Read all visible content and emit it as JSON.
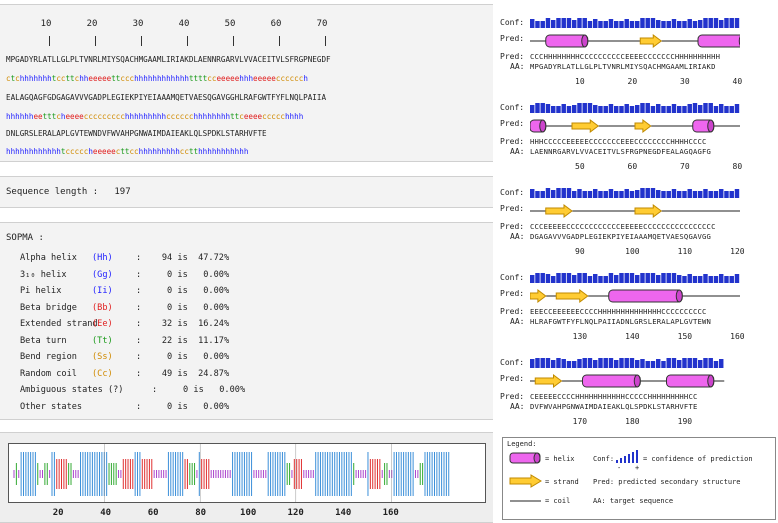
{
  "sequence_panel": {
    "ruler_labels": [
      "10",
      "20",
      "30",
      "40",
      "50",
      "60",
      "70"
    ],
    "lines": [
      {
        "aa": "MPGADYRLATLLGLPLTVNRLMIYSQACHMGAAMLIRIAKDLAENNRGARVLVVACEITVLSFRGPNEGDF",
        "ss": "ctchhhhhhhtccttchheeeeettccchhhhhhhhhhhhttttcceeeeehhheeeeecccccch"
      },
      {
        "aa": "EALAGQAGFGDGAGAVVVGADPLEGIEKPIYEIAAAMQETVAESQGAVGGHLRAFGWTFYFLNQLPAIIA",
        "ss": "hhhhhheetttcheeeeccccccccchhhhhhhhhcccccchhhhhhhhttceeeeccccchhhh"
      },
      {
        "aa": "DNLGRSLERALAPLGVTEWNDVFWVAHPGNWAIMDAIEAKLQLSPDKLSTARHVFTE",
        "ss": "hhhhhhhhhhhhtcccccheeeeecttcchhhhhhhhhcctthhhhhhhhhhh"
      }
    ]
  },
  "length_row": {
    "label": "Sequence length :",
    "value": "197"
  },
  "sopma": {
    "title": "SOPMA :",
    "rows": [
      {
        "name": "Alpha helix",
        "code": "(Hh)",
        "color": "#2222ff",
        "rest": ":    94 is  47.72%"
      },
      {
        "name": "3₁₀ helix",
        "code": "(Gg)",
        "color": "#2222ff",
        "rest": ":     0 is   0.00%"
      },
      {
        "name": "Pi helix",
        "code": "(Ii)",
        "color": "#2222ff",
        "rest": ":     0 is   0.00%"
      },
      {
        "name": "Beta bridge",
        "code": "(Bb)",
        "color": "#e02020",
        "rest": ":     0 is   0.00%"
      },
      {
        "name": "Extended strand",
        "code": "(Ee)",
        "color": "#e02020",
        "rest": ":    32 is  16.24%"
      },
      {
        "name": "Beta turn",
        "code": "(Tt)",
        "color": "#1a9a1a",
        "rest": ":    22 is  11.17%"
      },
      {
        "name": "Bend region",
        "code": "(Ss)",
        "color": "#d08a00",
        "rest": ":     0 is   0.00%"
      },
      {
        "name": "Random coil",
        "code": "(Cc)",
        "color": "#d08a00",
        "rest": ":    49 is  24.87%"
      },
      {
        "name": "Ambiguous states (?)",
        "code": "",
        "color": "#222222",
        "rest": ":     0 is   0.00%"
      },
      {
        "name": "Other states",
        "code": "",
        "color": "#222222",
        "rest": ":     0 is   0.00%"
      }
    ]
  },
  "track_labels": [
    "20",
    "40",
    "60",
    "80",
    "100",
    "120",
    "140",
    "160"
  ],
  "psipred_blocks": [
    {
      "conf_label": "Conf:",
      "pred_label": "Pred:",
      "aa_label": "AA:",
      "pred": "CCCHHHHHHHHCCCCCCCCCCEEEECCCCCCCHHHHHHHHHH",
      "aa": "MPGADYRLATLLGLPLTVNRLMIYSQACHMGAAMLIRIAKD",
      "positions": [
        "10",
        "20",
        "30",
        "40"
      ]
    },
    {
      "conf_label": "Conf:",
      "pred_label": "Pred:",
      "aa_label": "AA:",
      "pred": "HHHCCCCCEEEEECCCCCCCEEECCCCCCCCHHHHCCCC",
      "aa": "LAENNRGARVLVVACEITVLSFRGPNEGDFEALAGQAGFG",
      "positions": [
        "50",
        "60",
        "70",
        "80"
      ]
    },
    {
      "conf_label": "Conf:",
      "pred_label": "Pred:",
      "aa_label": "AA:",
      "pred": "CCCEEEEECCCCCCCCCCCCEEEEECCCCCCCCCCCCCCCC",
      "aa": "DGAGAVVVGADPLEGIEKPIYEIAAAMQETVAESQGAVGG",
      "positions": [
        "90",
        "100",
        "110",
        "120"
      ]
    },
    {
      "conf_label": "Conf:",
      "pred_label": "Pred:",
      "aa_label": "AA:",
      "pred": "EEECCEEEEEECCCCHHHHHHHHHHHHHHCCCCCCCCCC",
      "aa": "HLRAFGWTFYFLNQLPAIIADNLGRSLERALAPLGVTEWN",
      "positions": [
        "130",
        "140",
        "150",
        "160"
      ]
    },
    {
      "conf_label": "Conf:",
      "pred_label": "Pred:",
      "aa_label": "AA:",
      "pred": "CEEEEECCCCHHHHHHHHHHHCCCCCHHHHHHHHHCC",
      "aa": "DVFWVAHPGNWAIMDAIEAKLQLSPDKLSTARHVFTE",
      "positions": [
        "170",
        "180",
        "190"
      ]
    }
  ],
  "legend": {
    "title": "Legend:",
    "helix": "= helix",
    "conf": "Conf:",
    "conf_desc": "= confidence of prediction",
    "minus": "-",
    "plus": "+",
    "strand": "= strand",
    "pred": "Pred: predicted secondary structure",
    "coil": "= coil",
    "aa": "AA: target sequence"
  },
  "colors": {
    "helix": "#ee66ee",
    "strand": "#ffcc33",
    "conf": "#2233cc",
    "track_helix": "#3b8fd9",
    "track_strand": "#e03030",
    "track_turn": "#33aa33",
    "track_coil": "#aa44cc"
  }
}
